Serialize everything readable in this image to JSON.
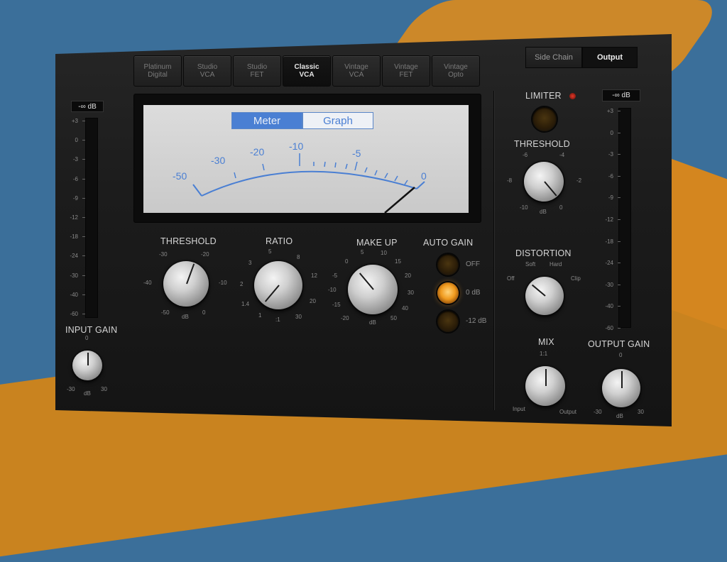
{
  "models": [
    {
      "line1": "Platinum",
      "line2": "Digital",
      "active": false
    },
    {
      "line1": "Studio",
      "line2": "VCA",
      "active": false
    },
    {
      "line1": "Studio",
      "line2": "FET",
      "active": false
    },
    {
      "line1": "Classic",
      "line2": "VCA",
      "active": true
    },
    {
      "line1": "Vintage",
      "line2": "VCA",
      "active": false
    },
    {
      "line1": "Vintage",
      "line2": "FET",
      "active": false
    },
    {
      "line1": "Vintage",
      "line2": "Opto",
      "active": false
    }
  ],
  "right_tabs": {
    "side_chain": "Side Chain",
    "output": "Output"
  },
  "view_toggle": {
    "meter": "Meter",
    "graph": "Graph"
  },
  "vu_scale": [
    "-50",
    "-30",
    "-20",
    "-10",
    "-5",
    "0"
  ],
  "input": {
    "readout": "-∞ dB",
    "scale": [
      "+3",
      "0",
      "-3",
      "-6",
      "-9",
      "-12",
      "-18",
      "-24",
      "-30",
      "-40",
      "-60"
    ],
    "label": "INPUT GAIN",
    "knob_labels": {
      "top": "0",
      "left": "-30",
      "center": "dB",
      "right": "30"
    }
  },
  "output": {
    "readout": "-∞ dB",
    "scale": [
      "+3",
      "0",
      "-3",
      "-6",
      "-9",
      "-12",
      "-18",
      "-24",
      "-30",
      "-40",
      "-60"
    ],
    "label": "OUTPUT GAIN",
    "knob_labels": {
      "top": "0",
      "left": "-30",
      "center": "dB",
      "right": "30"
    }
  },
  "threshold": {
    "label": "THRESHOLD",
    "scale": [
      "-30",
      "-20",
      "-40",
      "-10",
      "-50",
      "dB",
      "0"
    ]
  },
  "ratio": {
    "label": "RATIO",
    "scale": [
      "5",
      "3",
      "8",
      "2",
      "12",
      "1.4",
      "20",
      "1",
      ":1",
      "30"
    ]
  },
  "makeup": {
    "label": "MAKE UP",
    "scale": [
      "5",
      "10",
      "0",
      "15",
      "-5",
      "20",
      "-10",
      "30",
      "-15",
      "40",
      "-20",
      "dB",
      "50"
    ]
  },
  "auto_gain": {
    "label": "AUTO GAIN",
    "options": [
      "OFF",
      "0 dB",
      "-12 dB"
    ],
    "selected": "0 dB"
  },
  "limiter": {
    "label": "LIMITER"
  },
  "limiter_threshold": {
    "label": "THRESHOLD",
    "scale": [
      "-6",
      "-4",
      "-8",
      "-2",
      "-10",
      "dB",
      "0"
    ]
  },
  "distortion": {
    "label": "DISTORTION",
    "scale": [
      "Soft",
      "Hard",
      "Off",
      "Clip"
    ]
  },
  "mix": {
    "label": "MIX",
    "scale": [
      "1:1",
      "Input",
      "Output"
    ]
  },
  "colors": {
    "accent": "#4a7fd3",
    "led_on": "#f09a1e",
    "limiter_led": "#c0201a"
  }
}
